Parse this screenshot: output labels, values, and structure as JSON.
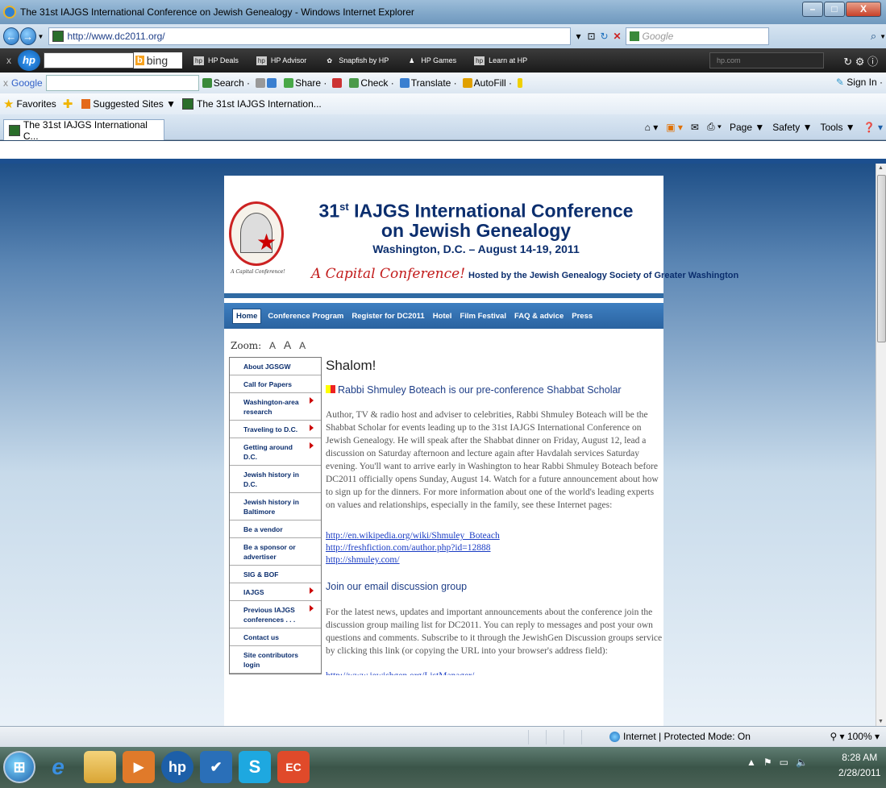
{
  "browser": {
    "window_title": "The 31st IAJGS International Conference on Jewish Genealogy - Windows Internet Explorer",
    "url": "http://www.dc2011.org/",
    "search_placeholder": "Google",
    "tab_title": "The 31st IAJGS International C...",
    "favorites_label": "Favorites",
    "suggested_sites_label": "Suggested Sites ▼",
    "fav_tab_label": "The 31st IAJGS Internation...",
    "command_bar": [
      "Page ▼",
      "Safety ▼",
      "Tools ▼"
    ]
  },
  "hp_toolbar": {
    "x_label": "x",
    "logo": "hp",
    "bing_label": "bing",
    "links": [
      "HP Deals",
      "HP Advisor",
      "Snapfish by HP",
      "HP Games",
      "Learn at HP"
    ],
    "hp_com_placeholder": "hp.com"
  },
  "google_toolbar": {
    "x_label": "x",
    "logo": "Google",
    "tools": [
      "Search ·",
      "Share ·",
      "Check ·",
      "Translate ·",
      "AutoFill ·"
    ],
    "sign_in": "Sign In ·"
  },
  "page": {
    "title_line1": "IAJGS International Conference",
    "title_ordinal": "31",
    "title_ordinal_suffix": "st",
    "title_line2": "on Jewish Genealogy",
    "subtitle": "Washington, D.C. – August 14-19, 2011",
    "tagline_italic": "A Capital Conference!",
    "tagline_host": "Hosted by the Jewish Genealogy Society of Greater Washington",
    "seal_caption": "A Capital Conference!",
    "nav": [
      "Home",
      "Conference Program",
      "Register for DC2011",
      "Hotel",
      "Film Festival",
      "FAQ & advice",
      "Press"
    ],
    "zoom_label": "Zoom:",
    "zoom_glyphs": [
      "A",
      "A",
      "A"
    ],
    "sidebar": [
      {
        "label": "About JGSGW",
        "arrow": false
      },
      {
        "label": "Call for Papers",
        "arrow": false
      },
      {
        "label": "Washington-area research",
        "arrow": true
      },
      {
        "label": "Traveling to D.C.",
        "arrow": true
      },
      {
        "label": "Getting around D.C.",
        "arrow": true
      },
      {
        "label": "Jewish history in D.C.",
        "arrow": false
      },
      {
        "label": "Jewish history in Baltimore",
        "arrow": false
      },
      {
        "label": "Be a vendor",
        "arrow": false
      },
      {
        "label": "Be a sponsor or advertiser",
        "arrow": false
      },
      {
        "label": "SIG & BOF",
        "arrow": false
      },
      {
        "label": "IAJGS",
        "arrow": true
      },
      {
        "label": "Previous IAJGS conferences . . .",
        "arrow": true
      },
      {
        "label": "Contact us",
        "arrow": false
      },
      {
        "label": "Site contributors login",
        "arrow": false
      }
    ],
    "greeting": "Shalom!",
    "headline1": "Rabbi Shmuley Boteach is our pre-conference Shabbat Scholar",
    "paragraph1": "Author, TV & radio host and adviser to celebrities, Rabbi Shmuley Boteach will be the Shabbat Scholar for events leading up to the 31st IAJGS International Conference on Jewish Genealogy. He will speak after the Shabbat dinner on Friday, August 12, lead a discussion on Saturday afternoon and lecture again after Havdalah services Saturday evening. You'll want to arrive early in Washington to hear Rabbi Shmuley Boteach before DC2011 officially opens Sunday, August 14. Watch for a future announcement about how to sign up for the dinners. For more information about one of the world's leading experts on values and relationships, especially in the family, see these Internet pages:",
    "links": [
      "http://en.wikipedia.org/wiki/Shmuley_Boteach",
      "http://freshfiction.com/author.php?id=12888",
      "http://shmuley.com/"
    ],
    "headline2": "Join our email discussion group",
    "paragraph2": "For the latest news, updates and important announcements about the conference join the discussion group mailing list for DC2011. You can reply to messages and post your own questions and comments. Subscribe to it through the JewishGen Discussion groups service by clicking this link (or copying the URL into your browser's address field):",
    "partial_link": "http://www.jewishgen.org/ListManager/..."
  },
  "status_bar": {
    "zone": "Internet | Protected Mode: On",
    "zoom": "100%"
  },
  "taskbar": {
    "time": "8:28 AM",
    "date": "2/28/2011"
  },
  "colors": {
    "brand_navy": "#0b2e6e",
    "nav_blue": "#2f6aa3",
    "tagline_red": "#c21b1b",
    "link_blue": "#1a3cc4"
  }
}
